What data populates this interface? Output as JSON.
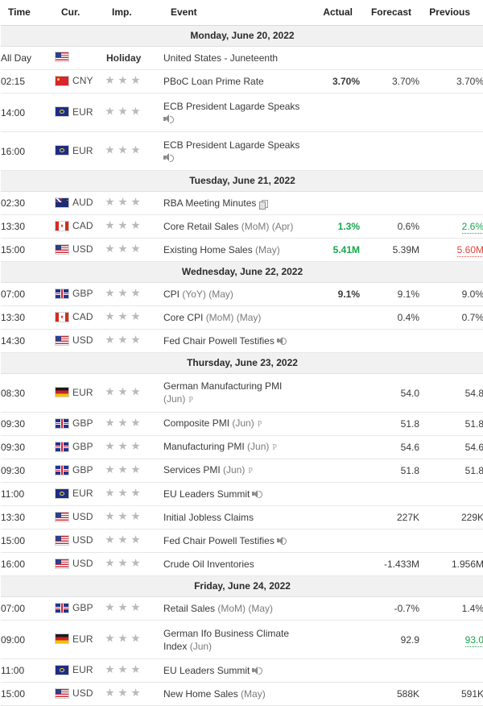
{
  "header": {
    "time": "Time",
    "currency": "Cur.",
    "importance": "Imp.",
    "event": "Event",
    "actual": "Actual",
    "forecast": "Forecast",
    "previous": "Previous"
  },
  "colors": {
    "positive": "#16a74a",
    "negative": "#e8403a",
    "text": "#333333",
    "date_band": "#f1f1f1",
    "star": "#b9b9bb"
  },
  "groups": [
    {
      "date": "Monday, June 20, 2022",
      "rows": [
        {
          "time": "All Day",
          "flag": "usd",
          "currency": "",
          "importance": 0,
          "holiday_label": "Holiday",
          "event": "United States - Juneteenth",
          "actual": "",
          "forecast": "",
          "previous": ""
        },
        {
          "time": "02:15",
          "flag": "cny",
          "currency": "CNY",
          "importance": 3,
          "event": "PBoC Loan Prime Rate",
          "actual": "3.70%",
          "forecast": "3.70%",
          "previous": "3.70%"
        },
        {
          "time": "14:00",
          "flag": "eur",
          "currency": "EUR",
          "importance": 3,
          "event": "ECB President Lagarde Speaks",
          "speaker": true,
          "two_line": true,
          "actual": "",
          "forecast": "",
          "previous": ""
        },
        {
          "time": "16:00",
          "flag": "eur",
          "currency": "EUR",
          "importance": 3,
          "event": "ECB President Lagarde Speaks",
          "speaker": true,
          "two_line": true,
          "actual": "",
          "forecast": "",
          "previous": ""
        }
      ]
    },
    {
      "date": "Tuesday, June 21, 2022",
      "rows": [
        {
          "time": "02:30",
          "flag": "aud",
          "currency": "AUD",
          "importance": 3,
          "event": "RBA Meeting Minutes",
          "doc": true,
          "actual": "",
          "forecast": "",
          "previous": ""
        },
        {
          "time": "13:30",
          "flag": "cad",
          "currency": "CAD",
          "importance": 3,
          "event": "Core Retail Sales (MoM) (Apr)",
          "actual": "1.3%",
          "actual_color": "green",
          "forecast": "0.6%",
          "previous": "2.6%",
          "previous_style": "revised-green"
        },
        {
          "time": "15:00",
          "flag": "usd",
          "currency": "USD",
          "importance": 3,
          "event": "Existing Home Sales (May)",
          "actual": "5.41M",
          "actual_color": "green",
          "forecast": "5.39M",
          "previous": "5.60M",
          "previous_style": "revised-red"
        }
      ]
    },
    {
      "date": "Wednesday, June 22, 2022",
      "rows": [
        {
          "time": "07:00",
          "flag": "gbp",
          "currency": "GBP",
          "importance": 3,
          "event": "CPI (YoY) (May)",
          "actual": "9.1%",
          "forecast": "9.1%",
          "previous": "9.0%"
        },
        {
          "time": "13:30",
          "flag": "cad",
          "currency": "CAD",
          "importance": 3,
          "event": "Core CPI (MoM) (May)",
          "actual": "",
          "forecast": "0.4%",
          "previous": "0.7%"
        },
        {
          "time": "14:30",
          "flag": "usd",
          "currency": "USD",
          "importance": 3,
          "event": "Fed Chair Powell Testifies",
          "speaker_inline": true,
          "actual": "",
          "forecast": "",
          "previous": ""
        }
      ]
    },
    {
      "date": "Thursday, June 23, 2022",
      "rows": [
        {
          "time": "08:30",
          "flag": "de",
          "currency": "EUR",
          "importance": 3,
          "event": "German Manufacturing PMI",
          "event_line2": "(Jun)",
          "badge": "P",
          "two_line": true,
          "actual": "",
          "forecast": "54.0",
          "previous": "54.8"
        },
        {
          "time": "09:30",
          "flag": "gbp",
          "currency": "GBP",
          "importance": 3,
          "event": "Composite PMI (Jun)",
          "badge": "P",
          "actual": "",
          "forecast": "51.8",
          "previous": "51.8"
        },
        {
          "time": "09:30",
          "flag": "gbp",
          "currency": "GBP",
          "importance": 3,
          "event": "Manufacturing PMI (Jun)",
          "badge": "P",
          "actual": "",
          "forecast": "54.6",
          "previous": "54.6"
        },
        {
          "time": "09:30",
          "flag": "gbp",
          "currency": "GBP",
          "importance": 3,
          "event": "Services PMI (Jun)",
          "badge": "P",
          "actual": "",
          "forecast": "51.8",
          "previous": "51.8"
        },
        {
          "time": "11:00",
          "flag": "eur",
          "currency": "EUR",
          "importance": 3,
          "event": "EU Leaders Summit",
          "speaker_inline": true,
          "actual": "",
          "forecast": "",
          "previous": ""
        },
        {
          "time": "13:30",
          "flag": "usd",
          "currency": "USD",
          "importance": 3,
          "event": "Initial Jobless Claims",
          "actual": "",
          "forecast": "227K",
          "previous": "229K"
        },
        {
          "time": "15:00",
          "flag": "usd",
          "currency": "USD",
          "importance": 3,
          "event": "Fed Chair Powell Testifies",
          "speaker_inline": true,
          "actual": "",
          "forecast": "",
          "previous": ""
        },
        {
          "time": "16:00",
          "flag": "usd",
          "currency": "USD",
          "importance": 3,
          "event": "Crude Oil Inventories",
          "actual": "",
          "forecast": "-1.433M",
          "previous": "1.956M"
        }
      ]
    },
    {
      "date": "Friday, June 24, 2022",
      "rows": [
        {
          "time": "07:00",
          "flag": "gbp",
          "currency": "GBP",
          "importance": 3,
          "event": "Retail Sales (MoM) (May)",
          "actual": "",
          "forecast": "-0.7%",
          "previous": "1.4%"
        },
        {
          "time": "09:00",
          "flag": "de",
          "currency": "EUR",
          "importance": 3,
          "event": "German Ifo Business Climate",
          "event_line2": "Index (Jun)",
          "two_line": true,
          "actual": "",
          "forecast": "92.9",
          "previous": "93.0",
          "previous_style": "revised-green"
        },
        {
          "time": "11:00",
          "flag": "eur",
          "currency": "EUR",
          "importance": 3,
          "event": "EU Leaders Summit",
          "speaker_inline": true,
          "actual": "",
          "forecast": "",
          "previous": ""
        },
        {
          "time": "15:00",
          "flag": "usd",
          "currency": "USD",
          "importance": 3,
          "event": "New Home Sales (May)",
          "actual": "",
          "forecast": "588K",
          "previous": "591K"
        }
      ]
    }
  ]
}
